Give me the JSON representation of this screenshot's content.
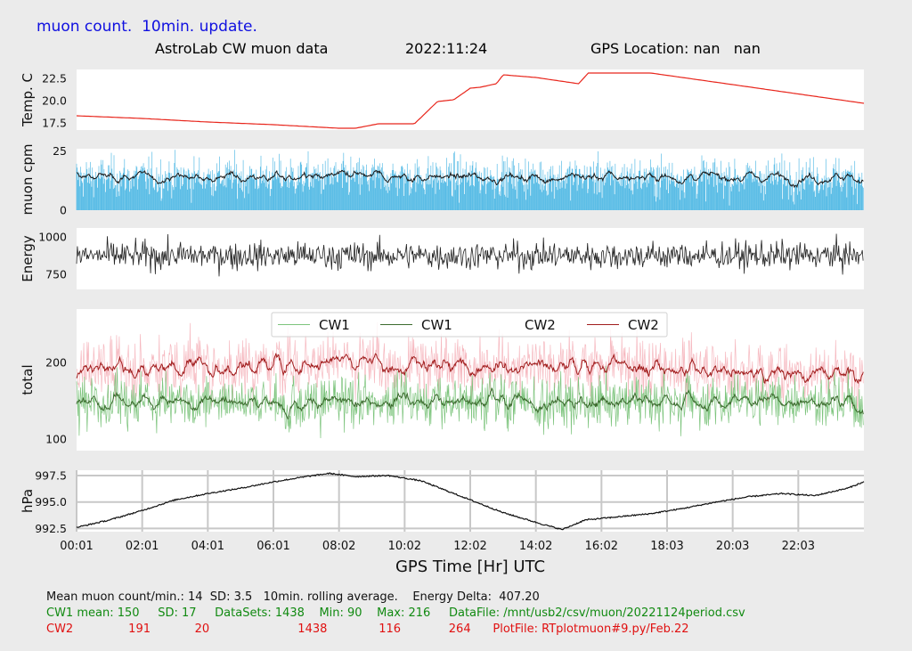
{
  "header": {
    "banner": "muon count.  10min. update.",
    "title": "AstroLab CW muon data",
    "date": "2022:11:24",
    "gps": "GPS Location: nan   nan"
  },
  "colors": {
    "banner": "#1010e0",
    "temp": "#e8261c",
    "cpm_bars": "#5bbde6",
    "cw1_light": "#7dc47d",
    "cw1_dark": "#3c6b2e",
    "cw2_light": "#f6b9c0",
    "cw2_dark": "#a11d1d",
    "footer_green": "#118a11",
    "footer_red": "#e01010"
  },
  "chart_data": [
    {
      "id": "temp",
      "type": "line",
      "ylabel": "Temp. C",
      "yticks": [
        "17.5",
        "20.0",
        "22.5"
      ],
      "ylim": [
        16.7,
        23.5
      ],
      "x": [
        0,
        2,
        4,
        6,
        8,
        8.5,
        9.2,
        10.3,
        11,
        11.5,
        12,
        12.3,
        12.8,
        13,
        14,
        15.3,
        15.6,
        17.5,
        20,
        24
      ],
      "y": [
        18.3,
        18.0,
        17.6,
        17.3,
        16.9,
        16.9,
        17.4,
        17.4,
        19.9,
        20.1,
        21.4,
        21.5,
        21.9,
        22.9,
        22.6,
        21.9,
        23.1,
        23.1,
        21.8,
        19.7
      ],
      "grid": false
    },
    {
      "id": "cpm",
      "type": "bar+line",
      "ylabel": "muon cpm",
      "yticks": [
        "0",
        "25"
      ],
      "ylim": [
        0,
        26
      ],
      "mean": 14,
      "sd": 3.5,
      "series": [
        {
          "legend": false,
          "style": "bars",
          "color_key": "cpm_bars"
        },
        {
          "legend": false,
          "style": "rolling-average",
          "color": "#1a1a1a"
        }
      ]
    },
    {
      "id": "energy",
      "type": "line",
      "ylabel": "Energy",
      "yticks": [
        "750",
        "1000"
      ],
      "ylim": [
        650,
        1060
      ],
      "mean": 875,
      "spread": 60
    },
    {
      "id": "total",
      "type": "line",
      "ylabel": "total",
      "yticks": [
        "100",
        "200"
      ],
      "ylim": [
        85,
        270
      ],
      "legend": {
        "placement": "top-center",
        "entries": [
          "CW1",
          "CW1",
          "CW2",
          "CW2"
        ]
      },
      "series": [
        {
          "name": "CW1",
          "style": "raw",
          "mean": 150,
          "sd": 17,
          "min": 90,
          "max": 216,
          "color_key": "cw1_light"
        },
        {
          "name": "CW1",
          "style": "rolling-average",
          "mean": 150,
          "color_key": "cw1_dark"
        },
        {
          "name": "CW2",
          "style": "raw",
          "mean": 191,
          "sd": 20,
          "min": 116,
          "max": 264,
          "color_key": "cw2_light"
        },
        {
          "name": "CW2",
          "style": "rolling-average",
          "mean": 191,
          "color_key": "cw2_dark"
        }
      ]
    },
    {
      "id": "pressure",
      "type": "line",
      "ylabel": "hPa",
      "yticks": [
        "992.5",
        "995.0",
        "997.5"
      ],
      "ylim": [
        992.2,
        998.0
      ],
      "x": [
        0,
        1,
        2,
        3,
        4,
        5,
        6,
        7,
        7.7,
        8.5,
        9.5,
        10.5,
        12,
        13,
        14.2,
        14.8,
        15.5,
        16.5,
        17.5,
        18.5,
        19.5,
        20.5,
        21.5,
        22.5,
        23.5,
        24
      ],
      "y": [
        992.6,
        993.3,
        994.2,
        995.2,
        995.8,
        996.3,
        996.9,
        997.4,
        997.7,
        997.4,
        997.5,
        997.0,
        995.2,
        994.0,
        992.9,
        992.4,
        993.3,
        993.6,
        993.9,
        994.4,
        995.0,
        995.5,
        995.8,
        995.6,
        996.3,
        996.9
      ],
      "grid": true,
      "xlabel": "GPS Time  [Hr] UTC",
      "xticks": [
        "00:01",
        "02:01",
        "04:01",
        "06:01",
        "08:02",
        "10:02",
        "12:02",
        "14:02",
        "16:02",
        "18:03",
        "20:03",
        "22:03"
      ],
      "xlim": [
        0,
        24
      ]
    }
  ],
  "footer": {
    "line1": "Mean muon count/min.: 14  SD: 3.5   10min. rolling average.    Energy Delta:  407.20",
    "line2": "CW1 mean: 150     SD: 17     DataSets: 1438    Min: 90    Max: 216     DataFile: /mnt/usb2/csv/muon/20221124period.csv",
    "line3": "CW2               191            20                        1438              116             264      PlotFile: RTplotmuon#9.py/Feb.22"
  }
}
